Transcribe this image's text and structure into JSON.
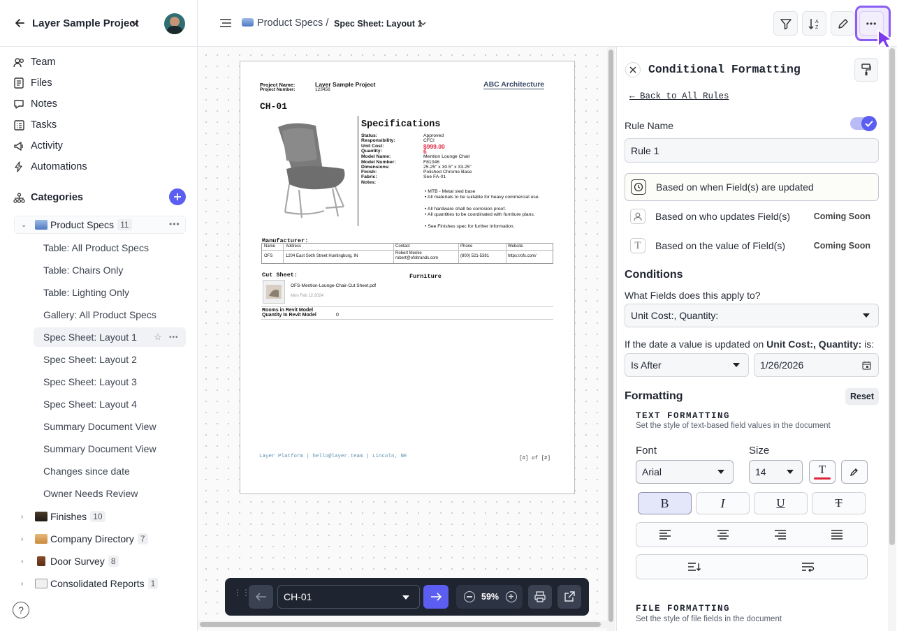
{
  "sidebar": {
    "project_title": "Layer Sample Project",
    "nav": [
      {
        "label": "Team",
        "icon": "team-icon"
      },
      {
        "label": "Files",
        "icon": "files-icon"
      },
      {
        "label": "Notes",
        "icon": "notes-icon"
      },
      {
        "label": "Tasks",
        "icon": "tasks-icon"
      },
      {
        "label": "Activity",
        "icon": "activity-icon"
      },
      {
        "label": "Automations",
        "icon": "automations-icon"
      }
    ],
    "categories_label": "Categories",
    "product_specs": {
      "label": "Product Specs",
      "count": "11"
    },
    "views": [
      "Table: All Product Specs",
      "Table: Chairs Only",
      "Table: Lighting Only",
      "Gallery: All Product Specs",
      "Spec Sheet: Layout 1",
      "Spec Sheet: Layout 2",
      "Spec Sheet: Layout 3",
      "Spec Sheet: Layout 4",
      "Summary Document View",
      "Summary Document View",
      "Changes since date",
      "Owner Needs Review"
    ],
    "other_categories": [
      {
        "label": "Finishes",
        "count": "10"
      },
      {
        "label": "Company Directory",
        "count": "7"
      },
      {
        "label": "Door Survey",
        "count": "8"
      },
      {
        "label": "Consolidated Reports",
        "count": "1"
      }
    ],
    "help": "?"
  },
  "header": {
    "breadcrumb_parent": "Product Specs /",
    "breadcrumb_current": "Spec Sheet: Layout 1"
  },
  "document": {
    "project_name_label": "Project Name:",
    "project_name": "Layer Sample Project",
    "project_number_label": "Project Number:",
    "project_number": "123456",
    "firm": "ABC Architecture",
    "code": "CH-01",
    "spec_title": "Specifications",
    "spec_rows": [
      {
        "k": "Status:",
        "v": "Approved"
      },
      {
        "k": "Responsibility:",
        "v": "CFCI"
      },
      {
        "k": "Unit Cost:",
        "v": "$999.00"
      },
      {
        "k": "Quantity:",
        "v": "6"
      },
      {
        "k": "Model Name:",
        "v": "Mention Lounge Chair"
      },
      {
        "k": "Model Number:",
        "v": "F81046"
      },
      {
        "k": "Dimensions:",
        "v": "25.25\" x 30.5\" x 33.25\""
      },
      {
        "k": "Finish:",
        "v": "Polished Chrome Base"
      },
      {
        "k": "Fabric:",
        "v": "See FA-01"
      },
      {
        "k": "Notes:",
        "v": ""
      }
    ],
    "notes": [
      "MTB - Metal sled base",
      "All materials to be suitable for heavy commercial use.",
      "All hardware shall be corrosion proof.",
      "All quantities to be coordinated with furniture plans.",
      "See Finishes spec for further information."
    ],
    "manufacturer_label": "Manufacturer:",
    "mfr_headers": [
      "Name",
      "Address",
      "Contact",
      "Phone",
      "Website"
    ],
    "mfr_row": [
      "OFS",
      "1204 East Sixth Street Huntingburg, IN",
      "Robert Menke",
      "(800) 521-5381",
      "https://ofs.com/"
    ],
    "mfr_email": "robert@ofsbrands.com",
    "cut_sheet_label": "Cut Sheet:",
    "furniture_label": "Furniture",
    "file_name": "OFS-Mention-Lounge-Chair-Cut Sheet.pdf",
    "file_date": "Mon Feb 12 2024",
    "rooms_label": "Rooms in Revit Model",
    "qty_revit_label": "Quantity In Revit Model",
    "qty_revit_value": "0",
    "footer_left": "Layer Platform | hello@layer.team | Lincoln, NE",
    "footer_right": "[#] of [#]"
  },
  "bottom_bar": {
    "record": "CH-01",
    "zoom": "59%"
  },
  "panel": {
    "title": "Conditional Formatting",
    "back_link": "← Back to All Rules",
    "rule_name_label": "Rule Name",
    "rule_name_value": "Rule 1",
    "options": [
      {
        "label": "Based on when Field(s) are updated",
        "badge": ""
      },
      {
        "label": "Based on who updates Field(s)",
        "badge": "Coming Soon"
      },
      {
        "label": "Based on the value of Field(s)",
        "badge": "Coming Soon"
      }
    ],
    "conditions_heading": "Conditions",
    "fields_question": "What Fields does this apply to?",
    "fields_value": "Unit Cost:, Quantity:",
    "date_question_pre": "If the date a value is updated on ",
    "date_question_fields": "Unit Cost:, Quantity:",
    "date_question_post": " is:",
    "operator_value": "Is After",
    "date_value": "1/26/2026",
    "formatting_heading": "Formatting",
    "reset_label": "Reset",
    "text_formatting_title": "TEXT FORMATTING",
    "text_formatting_desc": "Set the style of text-based field values in the document",
    "font_label": "Font",
    "font_value": "Arial",
    "size_label": "Size",
    "size_value": "14",
    "file_formatting_title": "FILE FORMATTING",
    "file_formatting_desc": "Set the style of file fields in the document"
  },
  "colors": {
    "accent": "#5b5ef0",
    "highlight_border": "#8b5cf6",
    "price_red": "#e0263d"
  }
}
